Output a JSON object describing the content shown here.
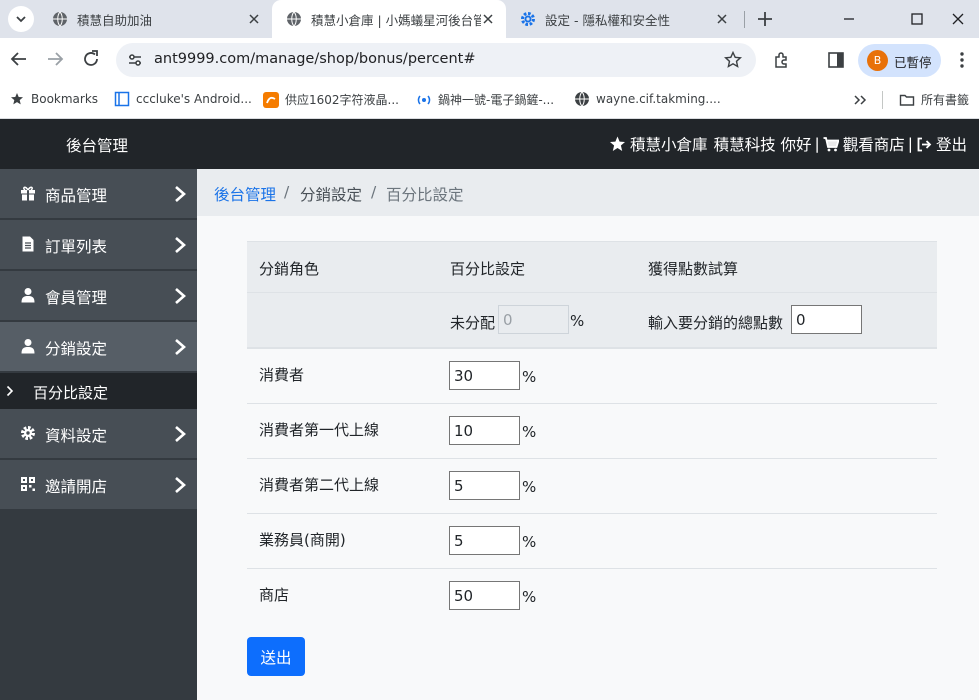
{
  "browser": {
    "tabs": [
      {
        "title": "積慧自助加油",
        "active": false
      },
      {
        "title": "積慧小倉庫 | 小媽蟻星河後台管",
        "active": true
      },
      {
        "title": "設定 - 隱私權和安全性",
        "active": false
      }
    ],
    "url": "ant9999.com/manage/shop/bonus/percent#",
    "profile": {
      "initial": "B",
      "label": "已暫停"
    },
    "bookmarks": [
      "Bookmarks",
      "cccluke's Android...",
      "供应1602字符液晶...",
      "鍋神一號-電子鍋鏟-...",
      "wayne.cif.takming...."
    ],
    "all_bookmarks": "所有書籤"
  },
  "header": {
    "brand": "後台管理",
    "store": "積慧小倉庫",
    "greeting": "積慧科技 你好",
    "sep": "|",
    "view_store": "觀看商店",
    "logout": "登出"
  },
  "sidebar": {
    "items": [
      {
        "label": "商品管理",
        "icon": "gift-icon"
      },
      {
        "label": "訂單列表",
        "icon": "file-icon"
      },
      {
        "label": "會員管理",
        "icon": "user-icon"
      },
      {
        "label": "分銷設定",
        "icon": "user-icon"
      },
      {
        "label": "資料設定",
        "icon": "gear-icon"
      },
      {
        "label": "邀請開店",
        "icon": "qrcode-icon"
      }
    ],
    "sub_item": "百分比設定"
  },
  "breadcrumb": {
    "home": "後台管理",
    "sep": "/",
    "section": "分銷設定",
    "current": "百分比設定"
  },
  "table": {
    "headers": [
      "分銷角色",
      "百分比設定",
      "獲得點數試算"
    ],
    "unassigned_label": "未分配",
    "unassigned_value": "0",
    "pct": "%",
    "total_points_label": "輸入要分銷的總點數",
    "total_points_value": "0",
    "rows": [
      {
        "role": "消費者",
        "value": "30"
      },
      {
        "role": "消費者第一代上線",
        "value": "10"
      },
      {
        "role": "消費者第二代上線",
        "value": "5"
      },
      {
        "role": "業務員(商開)",
        "value": "5"
      },
      {
        "role": "商店",
        "value": "50"
      }
    ]
  },
  "submit_label": "送出",
  "colors": {
    "primary": "#0d6efd",
    "header_bg": "#212529",
    "sidebar_bg": "#343a40",
    "link": "#1a73e8"
  }
}
